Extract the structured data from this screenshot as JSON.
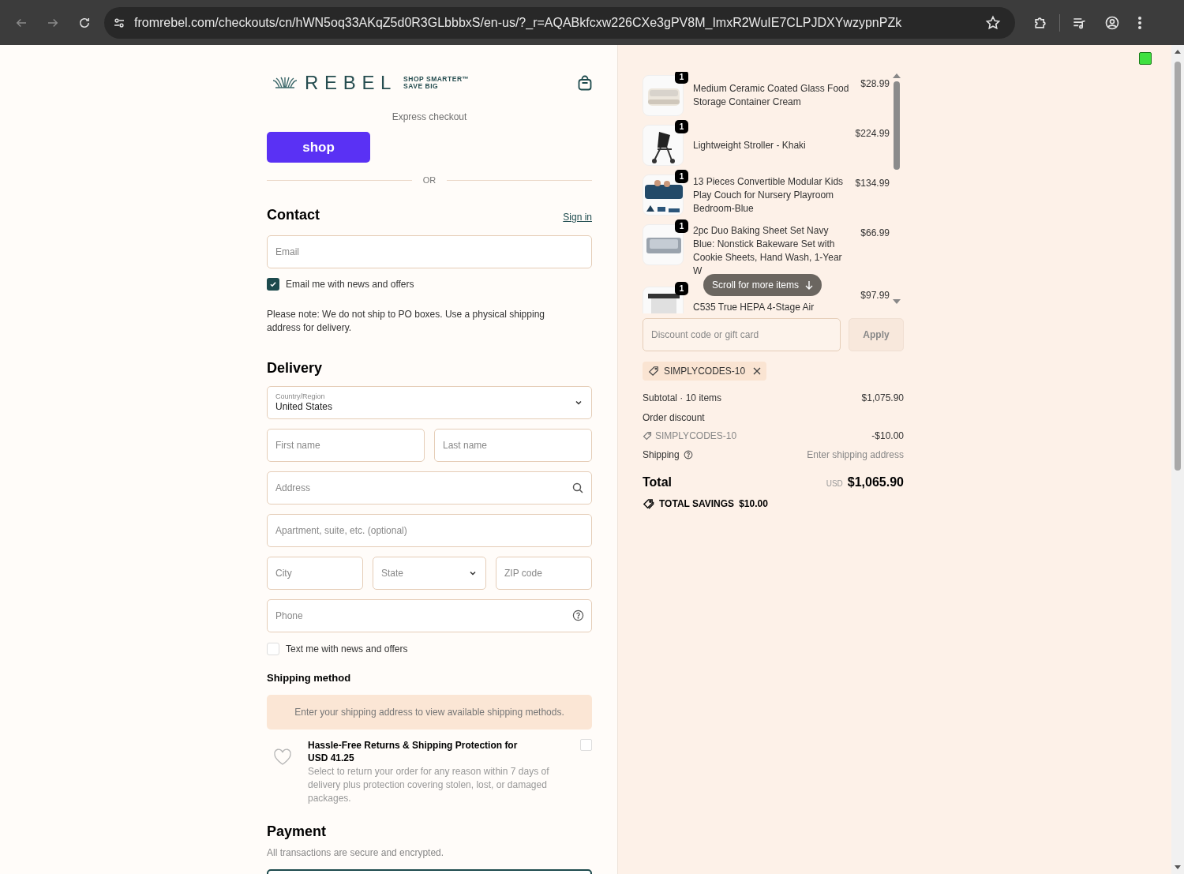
{
  "browser": {
    "url": "fromrebel.com/checkouts/cn/hWN5oq33AKqZ5d0R3GLbbbxS/en-us/?_r=AQABkfcxw226CXe3gPV8M_ImxR2WuIE7CLPJDXYwzypnPZk"
  },
  "header": {
    "logo_word": "REBEL",
    "tagline_top": "SHOP SMARTER™",
    "tagline_bottom": "SAVE BIG"
  },
  "express": {
    "label": "Express checkout",
    "button": "shop",
    "divider": "OR"
  },
  "contact": {
    "title": "Contact",
    "sign_in": "Sign in",
    "email": {
      "placeholder": "Email"
    },
    "newsletter": {
      "label": "Email me with news and offers",
      "checked": true
    },
    "note": "Please note: We do not ship to PO boxes. Use a physical shipping address for delivery."
  },
  "delivery": {
    "title": "Delivery",
    "rows": [
      [
        {
          "kind": "floating-select",
          "label": "Country/Region",
          "value": "United States"
        }
      ],
      [
        {
          "kind": "text",
          "placeholder": "First name"
        },
        {
          "kind": "text",
          "placeholder": "Last name"
        }
      ],
      [
        {
          "kind": "search",
          "placeholder": "Address"
        }
      ],
      [
        {
          "kind": "text",
          "placeholder": "Apartment, suite, etc. (optional)"
        }
      ],
      [
        {
          "kind": "text",
          "placeholder": "City"
        },
        {
          "kind": "select",
          "placeholder": "State"
        },
        {
          "kind": "text",
          "placeholder": "ZIP code"
        }
      ],
      [
        {
          "kind": "help",
          "placeholder": "Phone"
        }
      ]
    ],
    "sms": {
      "label": "Text me with news and offers",
      "checked": false
    }
  },
  "shipping_method": {
    "title": "Shipping method",
    "notice": "Enter your shipping address to view available shipping methods."
  },
  "protection": {
    "title": "Hassle-Free Returns & Shipping Protection for USD 41.25",
    "description": "Select to return your order for any reason within 7 days of delivery plus protection covering stolen, lost, or damaged packages.",
    "checked": false
  },
  "payment": {
    "title": "Payment",
    "subtitle": "All transactions are secure and encrypted."
  },
  "summary": {
    "items": [
      {
        "qty": "1",
        "name": "Medium Ceramic Coated Glass Food Storage Container Cream",
        "price": "$28.99"
      },
      {
        "qty": "1",
        "name": "Lightweight Stroller - Khaki",
        "price": "$224.99"
      },
      {
        "qty": "1",
        "name": "13 Pieces Convertible Modular Kids Play Couch for Nursery Playroom Bedroom-Blue",
        "price": "$134.99"
      },
      {
        "qty": "1",
        "name": "2pc Duo Baking Sheet Set Navy Blue: Nonstick Bakeware Set with Cookie Sheets, Hand Wash, 1-Year W",
        "price": "$66.99"
      },
      {
        "qty": "1",
        "name": "C535 True HEPA 4-Stage Air",
        "price": "$97.99"
      }
    ],
    "scroll_hint": "Scroll for more items",
    "discount": {
      "placeholder": "Discount code or gift card",
      "button": "Apply"
    },
    "applied_code": "SIMPLYCODES-10",
    "subtotal": {
      "label": "Subtotal · 10 items",
      "value": "$1,075.90"
    },
    "order_discount": {
      "label": "Order discount",
      "code": "SIMPLYCODES-10",
      "value": "-$10.00"
    },
    "shipping": {
      "label": "Shipping",
      "value": "Enter shipping address"
    },
    "total": {
      "label": "Total",
      "currency": "USD",
      "amount": "$1,065.90"
    },
    "savings": {
      "label": "TOTAL SAVINGS",
      "amount": "$10.00"
    }
  }
}
